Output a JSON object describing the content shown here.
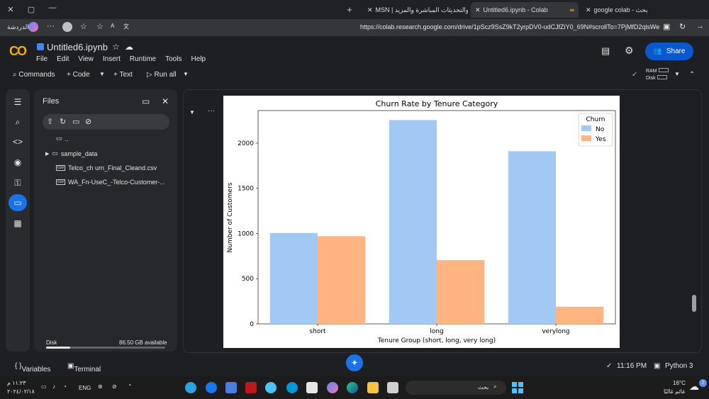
{
  "browser": {
    "tabs": [
      {
        "label": "MSN | والتحديثات المباشرة والمزيد"
      },
      {
        "label": "Untitled6.ipynb - Colab"
      },
      {
        "label": "google colab - بحث"
      }
    ],
    "profile_label": "الدردشة",
    "url": "https://colab.research.google.com/drive/1pScz9SsZ9kT2yrpDV0-udCJfZiY0_69N#scrollTo=7PjMfD2qlsWe"
  },
  "colab": {
    "logo": "CO",
    "notebook_title": "Untitled6.ipynb",
    "menu": [
      "File",
      "Edit",
      "View",
      "Insert",
      "Runtime",
      "Tools",
      "Help"
    ],
    "share_label": "Share",
    "toolbar": {
      "commands": "Commands",
      "code": "+ Code",
      "text": "+ Text",
      "run_all": "Run all"
    },
    "resources": {
      "ram": "RAM",
      "disk": "Disk"
    }
  },
  "files_panel": {
    "title": "Files",
    "items": [
      {
        "name": "..",
        "type": "folder"
      },
      {
        "name": "sample_data",
        "type": "folder"
      },
      {
        "name": "Telco_ch urn_Final_Cleand.csv",
        "type": "csv"
      },
      {
        "name": "WA_Fn-UseC_-Telco-Customer-...",
        "type": "csv"
      }
    ],
    "disk_label": "Disk",
    "disk_available": "86.50 GB available",
    "disk_used_fraction": 0.2
  },
  "chart_data": {
    "type": "bar",
    "title": "Churn Rate by Tenure Category",
    "xlabel": "Tenure Group (short, long, very long)",
    "ylabel": "Number of Customers",
    "categories": [
      "short",
      "long",
      "verylong"
    ],
    "series": [
      {
        "name": "No",
        "values": [
          1005,
          2255,
          1910
        ],
        "color": "#a1c9f4"
      },
      {
        "name": "Yes",
        "values": [
          970,
          705,
          190
        ],
        "color": "#ffb482"
      }
    ],
    "yticks": [
      0,
      500,
      1000,
      1500,
      2000
    ],
    "ylim": [
      0,
      2360
    ],
    "legend_title": "Churn",
    "legend_position": "top-right",
    "grid": false
  },
  "footer": {
    "variables": "Variables",
    "terminal": "Terminal",
    "time": "11:16 PM",
    "kernel": "Python 3"
  },
  "taskbar": {
    "search_placeholder": "بحث",
    "lang": "ENG",
    "clock_time": "١١:٢٣ م",
    "clock_date": "٢٠٢٤/٠٢/١٨",
    "weather_temp": "16°C",
    "weather_text": "غائم غالبًا",
    "notif_count": "2"
  }
}
